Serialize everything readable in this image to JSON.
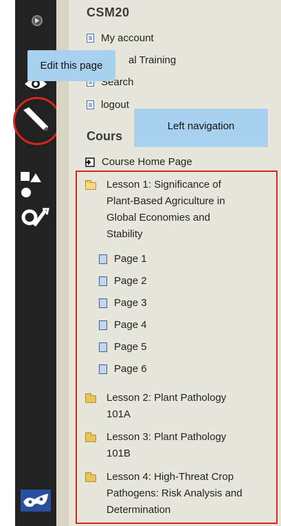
{
  "site": {
    "title": "CSM20"
  },
  "nav_links": [
    {
      "label": "My account",
      "icon": "document-icon"
    },
    {
      "label": "al Training",
      "icon": "document-icon"
    },
    {
      "label": "Search",
      "icon": "document-icon"
    },
    {
      "label": "logout",
      "icon": "document-icon"
    }
  ],
  "course": {
    "section_title": "Cours",
    "home_label": "Course Home Page",
    "lessons": [
      {
        "lines": [
          "Lesson 1: Significance of",
          "Plant-Based Agriculture in",
          "Global Economies and",
          "Stability"
        ],
        "state": "open"
      },
      {
        "lines": [
          "Lesson 2: Plant Pathology",
          "101A"
        ],
        "state": "closed"
      },
      {
        "lines": [
          "Lesson 3: Plant Pathology",
          "101B"
        ],
        "state": "closed"
      },
      {
        "lines": [
          "Lesson 4: High-Threat Crop",
          "Pathogens: Risk Analysis and",
          "Determination"
        ],
        "state": "closed"
      }
    ],
    "pages": [
      "Page 1",
      "Page 2",
      "Page 3",
      "Page 4",
      "Page 5",
      "Page 6"
    ]
  },
  "callouts": {
    "edit": "Edit this page",
    "nav": "Left navigation"
  },
  "toolbar": {
    "icons": [
      "arrow-circle-icon",
      "eye-icon",
      "pencil-icon",
      "shapes-icon",
      "gear-wrench-icon",
      "mask-icon"
    ]
  },
  "colors": {
    "highlight": "#d9261c",
    "callout": "#a8d0ef",
    "toolbar": "#222222",
    "background": "#e8e6da"
  }
}
